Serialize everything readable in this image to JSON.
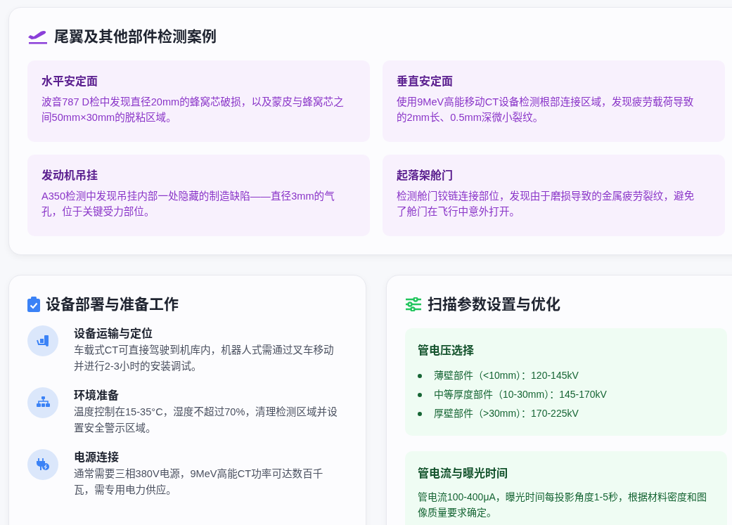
{
  "cases_section": {
    "title": "尾翼及其他部件检测案例",
    "cases": [
      {
        "title": "水平安定面",
        "text": "波音787 D检中发现直径20mm的蜂窝芯破损，以及蒙皮与蜂窝芯之间50mm×30mm的脱粘区域。"
      },
      {
        "title": "垂直安定面",
        "text": "使用9MeV高能移动CT设备检测根部连接区域，发现疲劳载荷导致的2mm长、0.5mm深微小裂纹。"
      },
      {
        "title": "发动机吊挂",
        "text": "A350检测中发现吊挂内部一处隐藏的制造缺陷——直径3mm的气孔，位于关键受力部位。"
      },
      {
        "title": "起落架舱门",
        "text": "检测舱门铰链连接部位，发现由于磨损导致的金属疲劳裂纹，避免了舱门在飞行中意外打开。"
      }
    ]
  },
  "deployment": {
    "title": "设备部署与准备工作",
    "steps": [
      {
        "title": "设备运输与定位",
        "text": "车载式CT可直接驾驶到机库内，机器人式需通过叉车移动并进行2-3小时的安装调试。"
      },
      {
        "title": "环境准备",
        "text": "温度控制在15-35°C，湿度不超过70%，清理检测区域并设置安全警示区域。"
      },
      {
        "title": "电源连接",
        "text": "通常需要三相380V电源，9MeV高能CT功率可达数百千瓦，需专用电力供应。"
      }
    ]
  },
  "scan_params": {
    "title": "扫描参数设置与优化",
    "blocks": [
      {
        "kind": "list",
        "title": "管电压选择",
        "items": [
          "薄壁部件（<10mm）：120-145kV",
          "中等厚度部件（10-30mm）：145-170kV",
          "厚壁部件（>30mm）：170-225kV"
        ]
      },
      {
        "kind": "paragraph",
        "title": "管电流与曝光时间",
        "text": "管电流100-400μA，曝光时间每投影角度1-5秒，根据材料密度和图像质量要求确定。"
      }
    ]
  }
}
